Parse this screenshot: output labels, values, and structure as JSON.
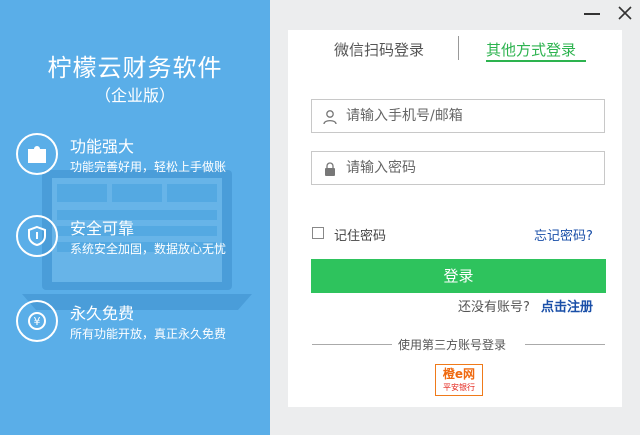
{
  "window": {
    "close_icon": "close-icon",
    "minimize_icon": "minimize-icon"
  },
  "left": {
    "title": "柠檬云财务软件",
    "subtitle": "（企业版）",
    "features": [
      {
        "title": "功能强大",
        "desc": "功能完善好用，轻松上手做账",
        "icon": "puzzle-icon"
      },
      {
        "title": "安全可靠",
        "desc": "系统安全加固，数据放心无忧",
        "icon": "shield-icon"
      },
      {
        "title": "永久免费",
        "desc": "所有功能开放，真正永久免费",
        "icon": "yen-icon"
      }
    ]
  },
  "tabs": {
    "wechat": "微信扫码登录",
    "other": "其他方式登录",
    "active": "other"
  },
  "form": {
    "phone_placeholder": "请输入手机号/邮箱",
    "password_placeholder": "请输入密码",
    "remember_label": "记住密码",
    "forgot_label": "忘记密码?",
    "login_label": "登录",
    "no_account": "还没有账号?",
    "register_label": "点击注册"
  },
  "third_party": {
    "label": "使用第三方账号登录",
    "bank_logo_text": "橙e网",
    "bank_name": "平安银行"
  },
  "colors": {
    "left_bg": "#5aaee8",
    "accent_green": "#2db34f",
    "button_green": "#2ec35d",
    "link_blue": "#1a4fa8"
  }
}
